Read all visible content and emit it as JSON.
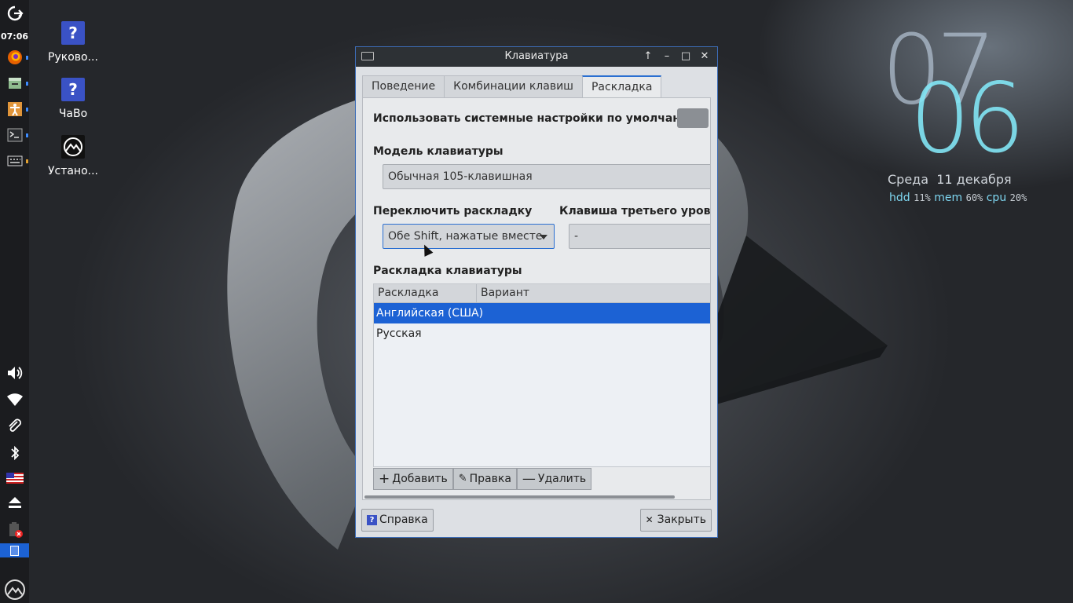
{
  "taskbar": {
    "time": "07:06",
    "top_icons": [
      "logout-icon",
      "firefox-icon",
      "files-icon",
      "accessibility-icon",
      "terminal-icon",
      "keyboard-icon"
    ],
    "bottom_icons": [
      "volume-icon",
      "wifi-icon",
      "clip-icon",
      "bluetooth-icon",
      "us-flag-icon",
      "eject-icon",
      "battery-icon",
      "workspace-icon",
      "menu-logo-icon"
    ]
  },
  "desktop": {
    "icons": [
      {
        "label": "Руково...",
        "icon": "help-icon"
      },
      {
        "label": "ЧаВо",
        "icon": "help-icon"
      },
      {
        "label": "Устано...",
        "icon": "installer-icon"
      }
    ]
  },
  "clock": {
    "hour": "07",
    "minute": "06",
    "date": "Среда  11 декабря",
    "hdd_label": "hdd",
    "hdd_value": "11%",
    "mem_label": "mem",
    "mem_value": "60%",
    "cpu_label": "cpu",
    "cpu_value": "20%"
  },
  "window": {
    "title": "Клавиатура",
    "tabs": [
      {
        "label": "Поведение"
      },
      {
        "label": "Комбинации клавиш"
      },
      {
        "label": "Раскладка"
      }
    ],
    "active_tab": "Раскладка",
    "use_system_defaults_label": "Использовать системные настройки по умолчанию",
    "use_system_defaults": false,
    "model_label": "Модель клавиатуры",
    "model_value": "Обычная 105-клавишная",
    "switch_label": "Переключить раскладку",
    "switch_value": "Обе Shift, нажатые вместе",
    "third_level_label": "Клавиша третьего уровня",
    "third_level_value": "-",
    "layouts_label": "Раскладка клавиатуры",
    "table": {
      "columns": [
        "Раскладка",
        "Вариант"
      ],
      "rows": [
        {
          "layout": "Английская (США)",
          "variant": "",
          "selected": true
        },
        {
          "layout": "Русская",
          "variant": "",
          "selected": false
        }
      ]
    },
    "add_label": "Добавить",
    "edit_label": "Правка",
    "remove_label": "Удалить",
    "help_label": "Справка",
    "close_label": "Закрыть"
  },
  "colors": {
    "accent": "#2a6fd1",
    "selection": "#1c62d4",
    "titlebar": "#2d3135",
    "clock_minute": "#82e6f5"
  }
}
